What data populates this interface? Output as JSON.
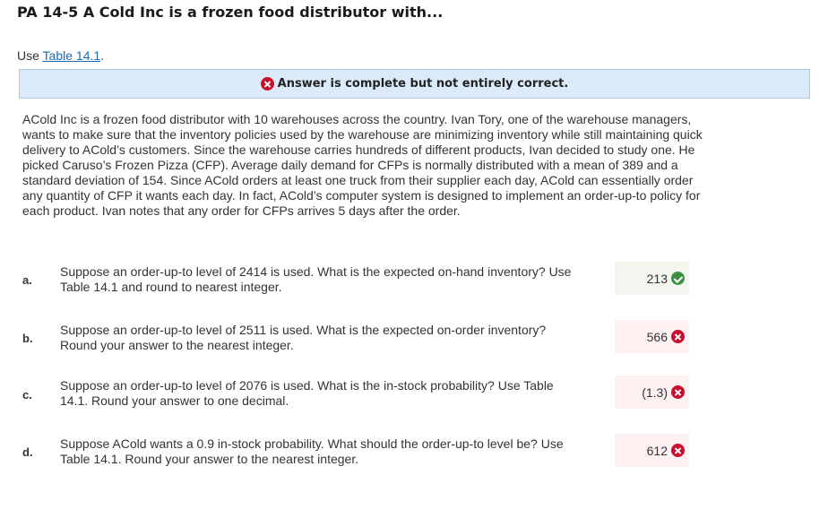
{
  "header": {
    "title": "PA 14-5 A Cold Inc is a frozen food distributor with..."
  },
  "instruction": {
    "prefix": "Use ",
    "link": "Table 14.1",
    "suffix": "."
  },
  "banner": {
    "icon": "x-circle-icon",
    "text": "Answer is complete but not entirely correct."
  },
  "problem_text": "ACold Inc is a frozen food distributor with 10 warehouses across the country. Ivan Tory, one of the warehouse managers, wants to make sure that the inventory policies used by the warehouse are minimizing inventory while still maintaining quick delivery to ACold’s customers. Since the warehouse carries hundreds of different products, Ivan decided to study one. He picked Caruso’s Frozen Pizza (CFP). Average daily demand for CFPs is normally distributed with a mean of 389 and a standard deviation of 154. Since ACold orders at least one truck from their supplier each day, ACold can essentially order any quantity of CFP it wants each day. In fact, ACold’s computer system is designed to implement an order-up-to policy for each product. Ivan notes that any order for CFPs arrives 5 days after the order.",
  "questions": [
    {
      "letter": "a.",
      "text": "Suppose an order-up-to level of 2414 is used. What is the expected on-hand inventory? Use Table 14.1 and round to nearest integer.",
      "answer": "213",
      "status": "correct"
    },
    {
      "letter": "b.",
      "text": "Suppose an order-up-to level of 2511 is used. What is the expected on-order inventory? Round your answer to the nearest integer.",
      "answer": "566",
      "status": "incorrect"
    },
    {
      "letter": "c.",
      "text": "Suppose an order-up-to level of 2076 is used. What is the in-stock probability? Use Table 14.1. Round your answer to one decimal.",
      "answer": "(1.3)",
      "status": "incorrect"
    },
    {
      "letter": "d.",
      "text": "Suppose ACold wants a 0.9 in-stock probability. What should the order-up-to level be? Use Table 14.1. Round your answer to the nearest integer.",
      "answer": "612",
      "status": "incorrect"
    }
  ],
  "colors": {
    "correct": "#3f9142",
    "incorrect": "#c8102e",
    "banner_bg": "#dbeaf8",
    "link": "#1a69b3"
  }
}
